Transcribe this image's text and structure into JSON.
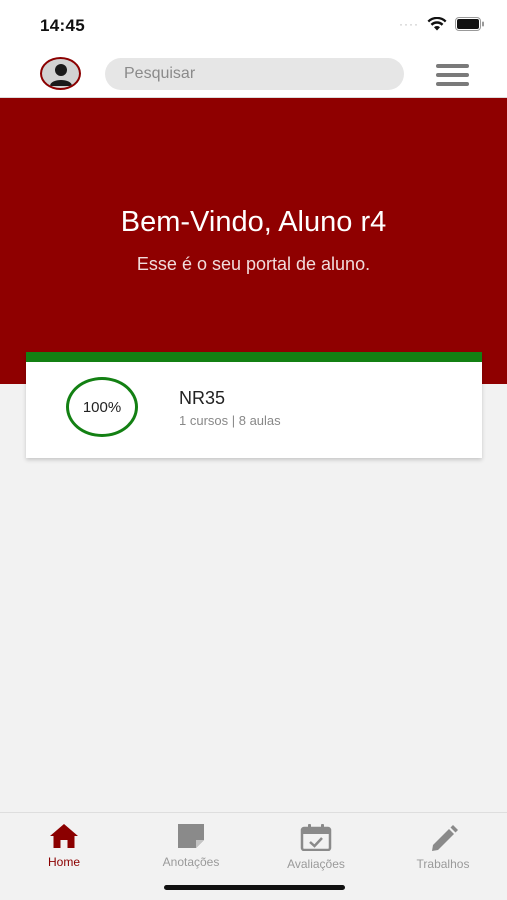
{
  "status_bar": {
    "time": "14:45"
  },
  "header": {
    "search_placeholder": "Pesquisar"
  },
  "hero": {
    "title": "Bem-Vindo, Aluno r4",
    "subtitle": "Esse é o seu portal de aluno."
  },
  "courses": [
    {
      "name": "NR35",
      "progress_label": "100%",
      "progress": 1.0,
      "meta": "1 cursos | 8 aulas"
    }
  ],
  "tabs": [
    {
      "label": "Home",
      "icon": "home-icon",
      "active": true
    },
    {
      "label": "Anotações",
      "icon": "note-icon",
      "active": false
    },
    {
      "label": "Avaliações",
      "icon": "calendar-check-icon",
      "active": false
    },
    {
      "label": "Trabalhos",
      "icon": "pencil-icon",
      "active": false
    }
  ],
  "colors": {
    "brand": "#8f0000",
    "progress": "#138013",
    "tab_active": "#8b0000",
    "tab_inactive": "#9a9a9a"
  }
}
